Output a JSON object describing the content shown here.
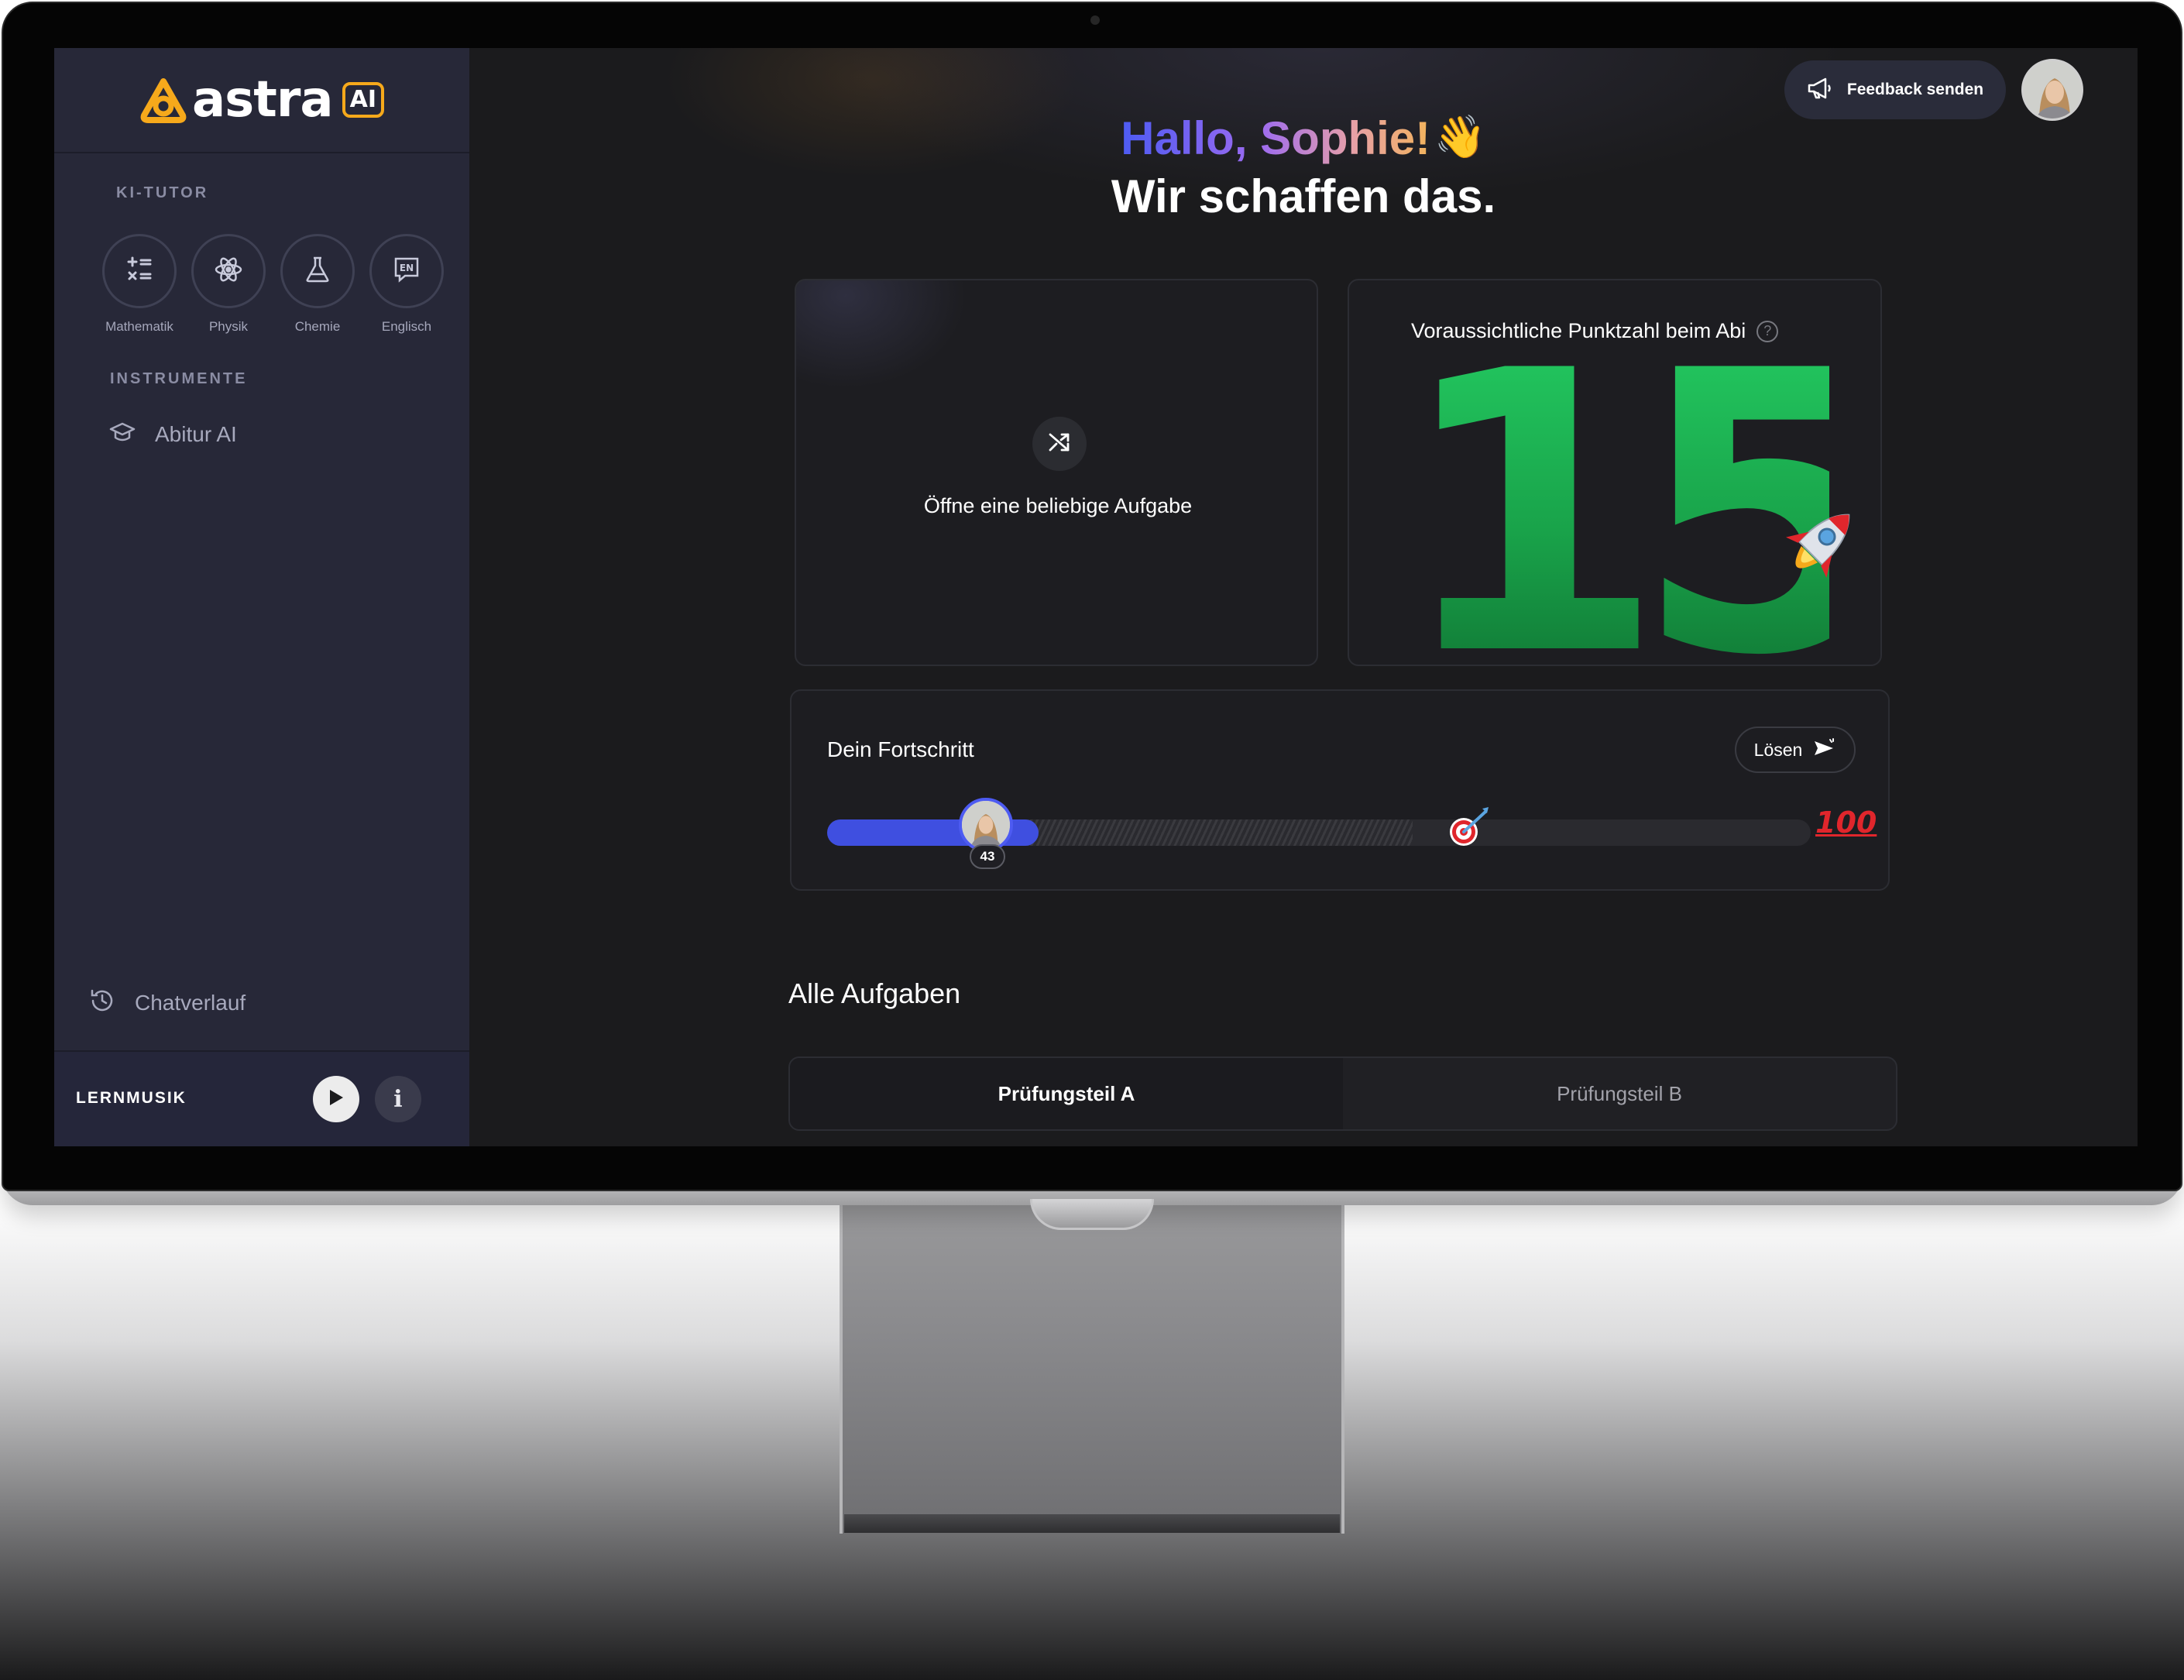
{
  "app": {
    "logo_text": "astra",
    "logo_badge": "AI"
  },
  "sidebar": {
    "tutor_section_label": "KI-TUTOR",
    "subjects": [
      {
        "label": "Mathematik",
        "icon": "math-operators-icon"
      },
      {
        "label": "Physik",
        "icon": "atom-icon"
      },
      {
        "label": "Chemie",
        "icon": "flask-icon"
      },
      {
        "label": "Englisch",
        "icon": "language-en-icon"
      }
    ],
    "tools_section_label": "INSTRUMENTE",
    "tools": [
      {
        "label": "Abitur AI",
        "icon": "graduation-cap-icon"
      }
    ],
    "history_label": "Chatverlauf",
    "music_label": "LERNMUSIK",
    "info_label": "i"
  },
  "header": {
    "feedback_label": "Feedback senden"
  },
  "greeting": {
    "line1": "Hallo, Sophie!",
    "wave": "👋",
    "line2": "Wir schaffen das."
  },
  "random_task": {
    "label": "Öffne eine beliebige Aufgabe"
  },
  "score": {
    "title": "Voraussichtliche Punktzahl beim Abi",
    "help": "?",
    "value": "15"
  },
  "progress": {
    "title": "Dein Fortschritt",
    "solve_label": "Lösen",
    "current": 43,
    "current_label": "43",
    "max_label": "100",
    "value_fraction": 0.43
  },
  "tasks": {
    "heading": "Alle Aufgaben",
    "tabs": [
      {
        "label": "Prüfungsteil A",
        "active": true
      },
      {
        "label": "Prüfungsteil B",
        "active": false
      }
    ]
  },
  "colors": {
    "accent": "#3f4fe0",
    "brand_orange": "#f6a91b",
    "score_green": "#22c55e",
    "sidebar_bg": "#272838",
    "main_bg": "#1b1b1d"
  }
}
